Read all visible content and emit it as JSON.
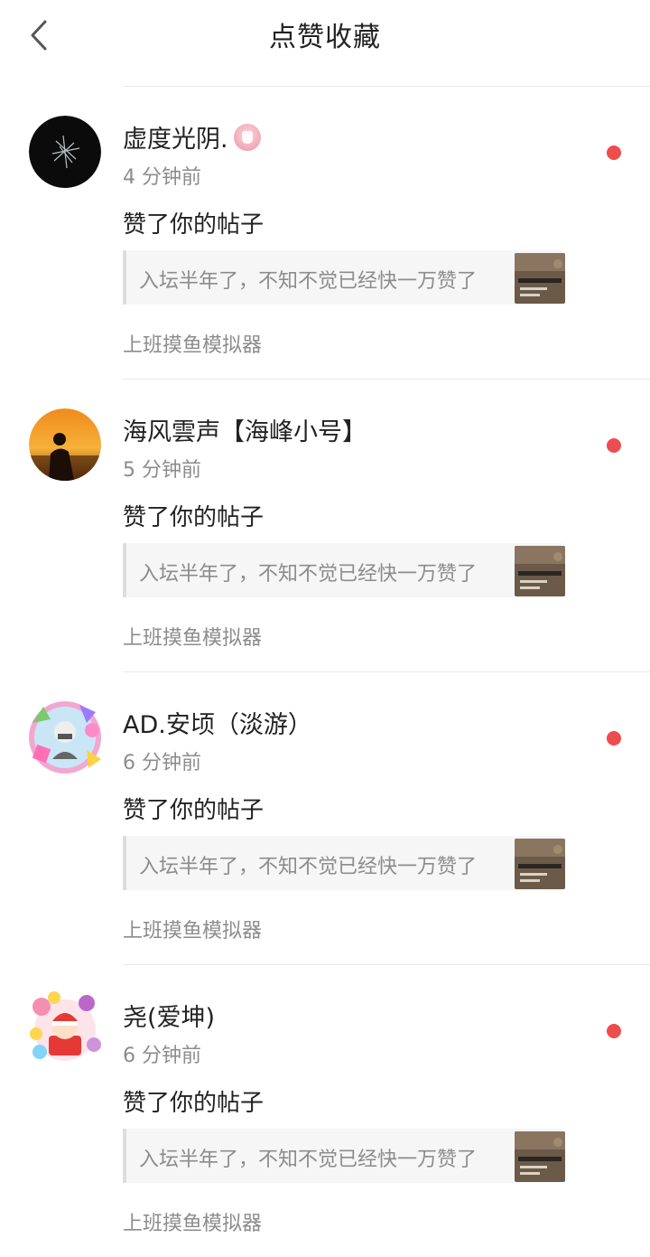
{
  "header": {
    "title": "点赞收藏",
    "back_icon": "chevron-left-icon"
  },
  "colors": {
    "unread_dot": "#ee4d4d",
    "secondary_text": "#8c8c8c",
    "card_bg": "#f6f6f6"
  },
  "items": [
    {
      "username": "虚度光阴.",
      "has_badge": true,
      "time": "4 分钟前",
      "action": "赞了你的帖子",
      "post_excerpt": "入坛半年了，不知不觉已经快一万赞了",
      "source": "上班摸鱼模拟器",
      "unread": true
    },
    {
      "username": "海风雲声【海峰小号】",
      "has_badge": false,
      "time": "5 分钟前",
      "action": "赞了你的帖子",
      "post_excerpt": "入坛半年了，不知不觉已经快一万赞了",
      "source": "上班摸鱼模拟器",
      "unread": true
    },
    {
      "username": "AD.安顷（淡游）",
      "has_badge": false,
      "time": "6 分钟前",
      "action": "赞了你的帖子",
      "post_excerpt": "入坛半年了，不知不觉已经快一万赞了",
      "source": "上班摸鱼模拟器",
      "unread": true
    },
    {
      "username": "尧(爱坤)",
      "has_badge": false,
      "time": "6 分钟前",
      "action": "赞了你的帖子",
      "post_excerpt": "入坛半年了，不知不觉已经快一万赞了",
      "source": "上班摸鱼模拟器",
      "unread": true
    }
  ]
}
